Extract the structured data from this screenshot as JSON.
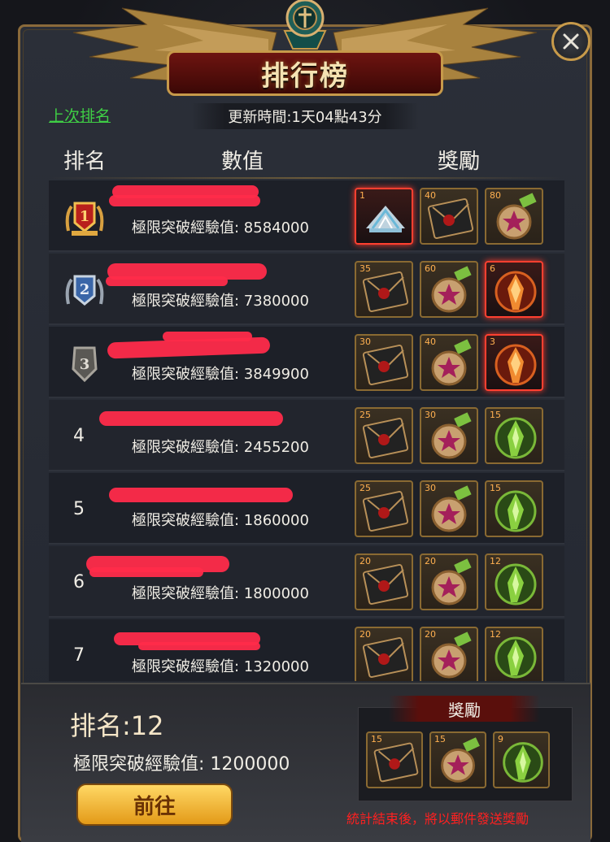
{
  "header": {
    "title": "排行榜",
    "last_rank_link": "上次排名",
    "update_time": "更新時間:1天04點43分"
  },
  "columns": {
    "rank": "排名",
    "value": "數值",
    "reward": "獎勵"
  },
  "rows": [
    {
      "rank": "1",
      "stat": "極限突破經驗值:  8584000",
      "rewards": [
        {
          "count": "1",
          "icon": "fan-crown-icon"
        },
        {
          "count": "40",
          "icon": "sealed-letter-icon"
        },
        {
          "count": "80",
          "icon": "star-medal-icon"
        }
      ]
    },
    {
      "rank": "2",
      "stat": "極限突破經驗值:  7380000",
      "rewards": [
        {
          "count": "35",
          "icon": "sealed-letter-icon"
        },
        {
          "count": "60",
          "icon": "star-medal-icon"
        },
        {
          "count": "6",
          "icon": "fire-crystal-icon"
        }
      ]
    },
    {
      "rank": "3",
      "stat": "極限突破經驗值:  3849900",
      "rewards": [
        {
          "count": "30",
          "icon": "sealed-letter-icon"
        },
        {
          "count": "40",
          "icon": "star-medal-icon"
        },
        {
          "count": "3",
          "icon": "fire-crystal-icon"
        }
      ]
    },
    {
      "rank": "4",
      "stat": "極限突破經驗值:  2455200",
      "rewards": [
        {
          "count": "25",
          "icon": "sealed-letter-icon"
        },
        {
          "count": "30",
          "icon": "star-medal-icon"
        },
        {
          "count": "15",
          "icon": "green-crystal-icon"
        }
      ]
    },
    {
      "rank": "5",
      "stat": "極限突破經驗值:  1860000",
      "rewards": [
        {
          "count": "25",
          "icon": "sealed-letter-icon"
        },
        {
          "count": "30",
          "icon": "star-medal-icon"
        },
        {
          "count": "15",
          "icon": "green-crystal-icon"
        }
      ]
    },
    {
      "rank": "6",
      "stat": "極限突破經驗值:  1800000",
      "rewards": [
        {
          "count": "20",
          "icon": "sealed-letter-icon"
        },
        {
          "count": "20",
          "icon": "star-medal-icon"
        },
        {
          "count": "12",
          "icon": "green-crystal-icon"
        }
      ]
    },
    {
      "rank": "7",
      "stat": "極限突破經驗值:  1320000",
      "rewards": [
        {
          "count": "20",
          "icon": "sealed-letter-icon"
        },
        {
          "count": "20",
          "icon": "star-medal-icon"
        },
        {
          "count": "12",
          "icon": "green-crystal-icon"
        }
      ]
    }
  ],
  "self": {
    "rank": "排名:12",
    "stat": "極限突破經驗值:  1200000",
    "go_button": "前往",
    "reward_title": "獎勵",
    "rewards": [
      {
        "count": "15",
        "icon": "sealed-letter-icon"
      },
      {
        "count": "15",
        "icon": "star-medal-icon"
      },
      {
        "count": "9",
        "icon": "green-crystal-icon"
      }
    ],
    "notice": "統計結束後，將以郵件發送獎勵"
  },
  "colors": {
    "accent_gold": "#c79a4a",
    "title_red": "#6e1410",
    "link_green": "#3fcf45",
    "notice_red": "#ff2020"
  }
}
